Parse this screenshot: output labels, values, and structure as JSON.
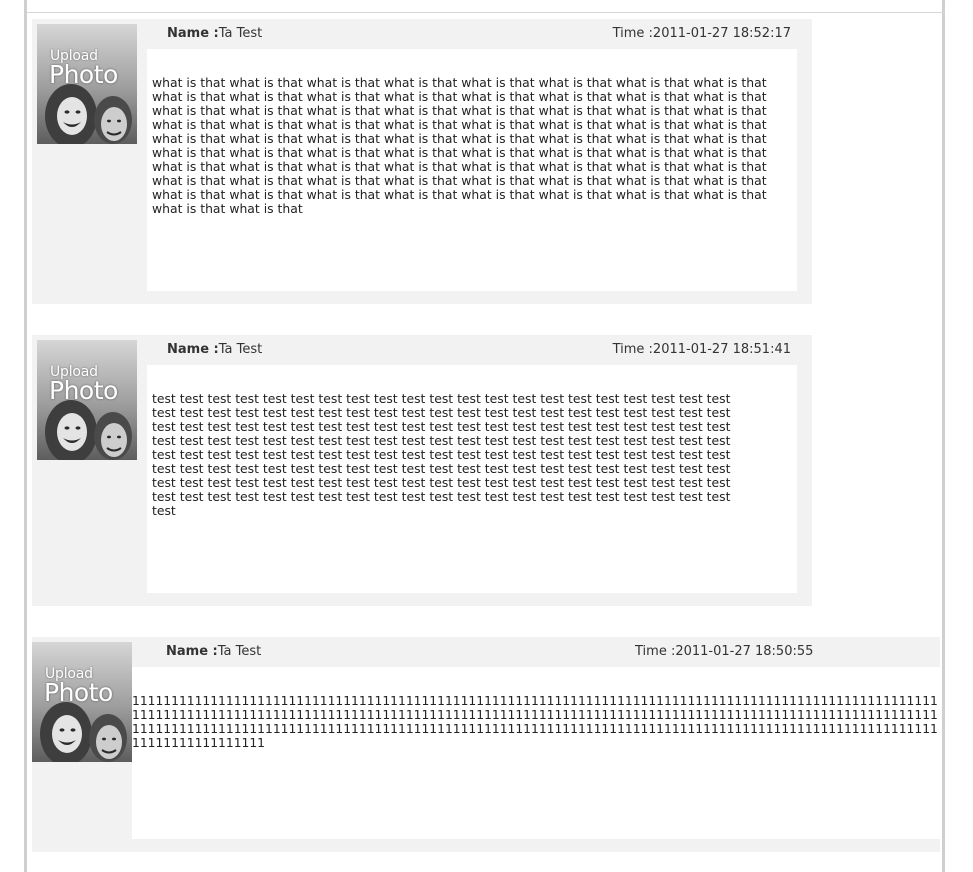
{
  "comments": [
    {
      "avatar": {
        "icon": "upload-photo-placeholder",
        "upload_text": "Upload",
        "photo_text": "Photo"
      },
      "name_label": "Name :",
      "name_value": "Ta Test",
      "time_label": "Time :",
      "time_value": "2011-01-27 18:52:17",
      "body": "what is that what is that what is that what is that what is that what is that what is that what is that what is that what is that what is that what is that what is that what is that what is that what is that what is that what is that what is that what is that what is that what is that what is that what is that what is that what is that what is that what is that what is that what is that what is that what is that what is that what is that what is that what is that what is that what is that what is that what is that what is that what is that what is that what is that what is that what is that what is that what is that what is that what is that what is that what is that what is that what is that what is that what is that what is that what is that what is that what is that what is that what is that what is that what is that what is that what is that what is that what is that what is that what is that what is that what is that what is that what is that"
    },
    {
      "avatar": {
        "icon": "upload-photo-placeholder",
        "upload_text": "Upload",
        "photo_text": "Photo"
      },
      "name_label": "Name :",
      "name_value": "Ta Test",
      "time_label": "Time :",
      "time_value": "2011-01-27 18:51:41",
      "body": "test test test test test test test test test test test test test test test test test test test test test test test test test test test test test test test test test test test test test test test test test test test test test test test test test test test test test test test test test test test test test test test test test test test test test test test test test test test test test test test test test test test test test test test test test test test test test test test test test test test test test test test test test test test test test test test test test test test test test test test test test test test test test test test test test test test test test test test test test test test test test test test test test test test test test test test test test test test test test test test test test test test test test test test test test"
    },
    {
      "avatar": {
        "icon": "upload-photo-placeholder",
        "upload_text": "Upload",
        "photo_text": "Photo"
      },
      "name_label": "Name :",
      "name_value": "Ta Test",
      "time_label": "Time :",
      "time_value": "2011-01-27 18:50:55",
      "body": "11111111111111111111111111111111111111111111111111111111111111111111111111111111111111111111111111111111111111111111111111111111111111111111111111111111111111111111111111111111111111111111111111111111111111111111111111111111111111111111111111111111111111111111111111111111111111111111111111111111111111111111111111111111111111"
    }
  ],
  "colors": {
    "panel_bg": "#f2f2f2",
    "body_bg": "#ffffff",
    "frame_border": "#cfcfcf",
    "text": "#333333"
  }
}
